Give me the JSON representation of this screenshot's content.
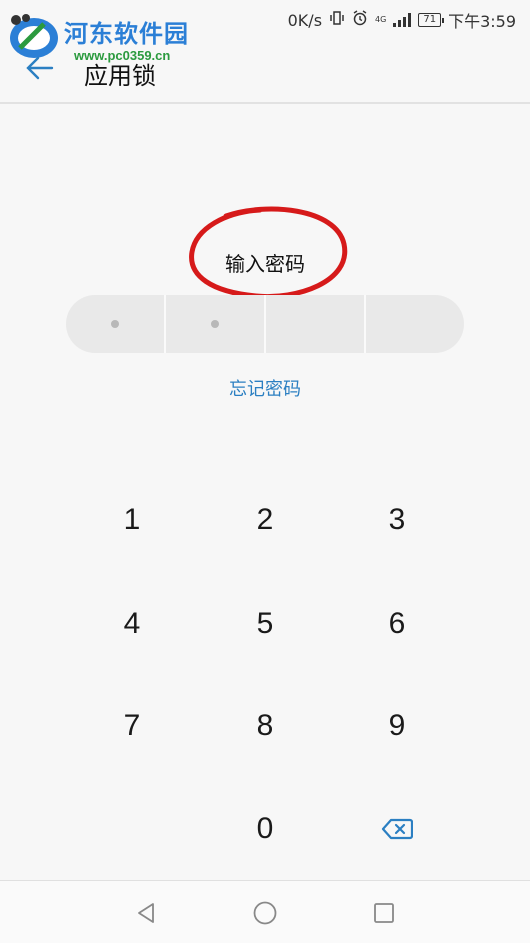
{
  "watermark": {
    "name": "河东软件园",
    "url": "www.pc0359.cn"
  },
  "status": {
    "speed": "0K/s",
    "network": "4G",
    "battery": "71",
    "time": "下午3:59"
  },
  "header": {
    "title": "应用锁",
    "back_icon": "arrow-left-icon"
  },
  "lock": {
    "prompt": "输入密码",
    "pin_length": 4,
    "digits_entered": 2,
    "forgot_label": "忘记密码"
  },
  "keypad": {
    "keys": [
      "1",
      "2",
      "3",
      "4",
      "5",
      "6",
      "7",
      "8",
      "9",
      "0"
    ],
    "delete_icon": "backspace-icon"
  },
  "nav": {
    "back_icon": "triangle-back-icon",
    "home_icon": "circle-home-icon",
    "recents_icon": "square-recents-icon"
  },
  "colors": {
    "accent": "#2b7fc2",
    "annotation": "#d61a1a",
    "watermark_blue": "#2b7fd6",
    "watermark_green": "#2b9a3e"
  }
}
